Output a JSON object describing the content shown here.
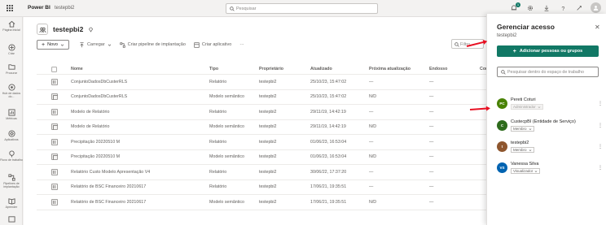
{
  "topbar": {
    "app_name": "Power BI",
    "workspace_crumb": "testepbi2",
    "search_placeholder": "Pesquisar",
    "notification_count": "1",
    "icons": [
      "notifications-icon",
      "settings-icon",
      "download-icon",
      "help-icon",
      "feedback-icon",
      "account-icon"
    ]
  },
  "leftnav": {
    "items": [
      {
        "label": "Página Inicial",
        "icon": "home-icon"
      },
      {
        "label": "Criar",
        "icon": "create-icon"
      },
      {
        "label": "Procurar",
        "icon": "browse-icon"
      },
      {
        "label": "Hub de dados do...",
        "icon": "data-hub-icon"
      },
      {
        "label": "Métricas",
        "icon": "metrics-icon"
      },
      {
        "label": "Aplicativos",
        "icon": "apps-icon"
      },
      {
        "label": "Fluxo de trabalho",
        "icon": "workflow-icon"
      },
      {
        "label": "Pipelines de implantação",
        "icon": "deployment-pipelines-icon"
      },
      {
        "label": "Aprender",
        "icon": "learn-icon"
      },
      {
        "label": "Workspaces",
        "icon": "workspaces-icon"
      }
    ]
  },
  "workspace": {
    "title": "testepbi2"
  },
  "toolbar": {
    "new_label": "Novo",
    "upload_label": "Carregar",
    "pipeline_label": "Criar pipeline de implantação",
    "app_label": "Criar aplicativo",
    "more_label": "···",
    "filter_placeholder": "Filtro"
  },
  "table": {
    "headers": {
      "name": "Nome",
      "type": "Tipo",
      "owner": "Proprietário",
      "updated": "Atualizado",
      "next_refresh": "Próxima atualização",
      "endorsement": "Endosso",
      "confidentiality": "Confi"
    },
    "rows": [
      {
        "kind": "report",
        "name": "ConjuntoDadosDbCusterRLS",
        "type": "Relatório",
        "owner": "testepbi2",
        "updated": "25/10/23, 15:47:02",
        "next": "—",
        "endorse": "—"
      },
      {
        "kind": "model",
        "name": "ConjuntoDadosDbCusterRLS",
        "type": "Modelo semântico",
        "owner": "testepbi2",
        "updated": "25/10/23, 15:47:02",
        "next": "N/D",
        "endorse": "—"
      },
      {
        "kind": "report",
        "name": "Modelo de Relatório",
        "type": "Relatório",
        "owner": "testepbi2",
        "updated": "29/11/19, 14:42:19",
        "next": "—",
        "endorse": "—"
      },
      {
        "kind": "model",
        "name": "Modelo de Relatório",
        "type": "Modelo semântico",
        "owner": "testepbi2",
        "updated": "29/11/19, 14:42:19",
        "next": "N/D",
        "endorse": "—"
      },
      {
        "kind": "report",
        "name": "Precipitação 20220510 M",
        "type": "Relatório",
        "owner": "testepbi2",
        "updated": "01/06/23, 16:53:04",
        "next": "—",
        "endorse": "—"
      },
      {
        "kind": "model",
        "name": "Precipitação 20220510 M",
        "type": "Modelo semântico",
        "owner": "testepbi2",
        "updated": "01/06/23, 16:53:04",
        "next": "N/D",
        "endorse": "—"
      },
      {
        "kind": "report",
        "name": "Relatório Custo Modelo Apresentação V4",
        "type": "Relatório",
        "owner": "testepbi2",
        "updated": "30/06/22, 17:37:20",
        "next": "—",
        "endorse": "—"
      },
      {
        "kind": "report",
        "name": "Relatório de BSC Financeiro 20210617",
        "type": "Relatório",
        "owner": "testepbi2",
        "updated": "17/06/21, 19:35:51",
        "next": "—",
        "endorse": "—"
      },
      {
        "kind": "report",
        "name": "Relatório de BSC Financeiro 20210617",
        "type": "Modelo semântico",
        "owner": "testepbi2",
        "updated": "17/06/21, 19:35:51",
        "next": "N/D",
        "endorse": "—"
      }
    ]
  },
  "panel": {
    "title": "Gerenciar acesso",
    "subtitle": "testepbi2",
    "add_button": "Adicionar pessoas ou grupos",
    "search_placeholder": "Pesquisar dentro do espaço de trabalho",
    "members": [
      {
        "initials": "PC",
        "name": "Pereti Coturi",
        "role": "Administrador",
        "color": "#498205",
        "disabled": true
      },
      {
        "initials": "C",
        "name": "CustecpBI (Entidade de Serviço)",
        "role": "Membro",
        "color": "#2e6b1c",
        "disabled": false
      },
      {
        "initials": "t",
        "name": "testepbi2",
        "role": "Membro",
        "color": "#8e562e",
        "disabled": false
      },
      {
        "initials": "VS",
        "name": "Vanessa Silva",
        "role": "Visualizador",
        "color": "#0063b1",
        "disabled": false
      }
    ]
  },
  "colors": {
    "accent": "#117865",
    "arrow": "#e81123"
  }
}
